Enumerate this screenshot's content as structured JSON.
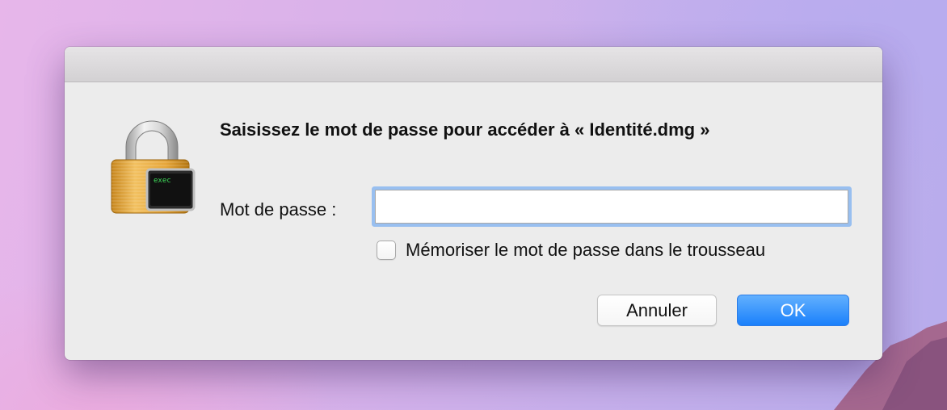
{
  "dialog": {
    "title": "Saisissez le mot de passe pour accéder à « Identité.dmg »",
    "password_label": "Mot de passe :",
    "password_value": "",
    "remember_label": "Mémoriser le mot de passe dans le trousseau",
    "remember_checked": false,
    "cancel_label": "Annuler",
    "ok_label": "OK"
  },
  "icon": {
    "name": "padlock-terminal-icon",
    "badge_text": "exec"
  },
  "colors": {
    "accent": "#1a80fb",
    "focus_ring": "#98bff0"
  }
}
